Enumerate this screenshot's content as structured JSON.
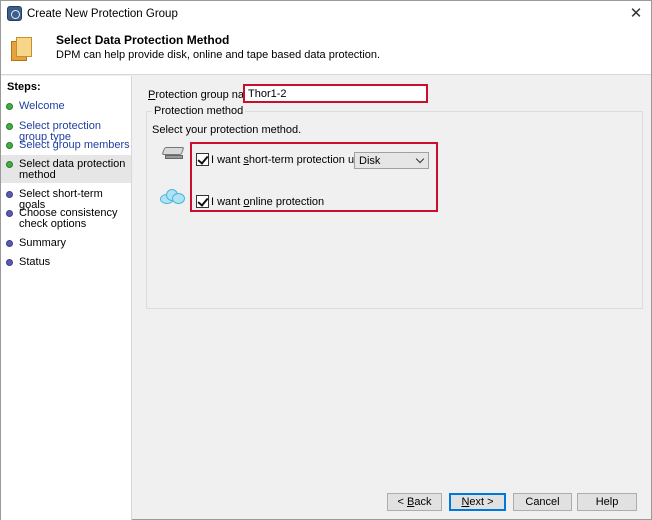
{
  "window": {
    "title": "Create New Protection Group",
    "close_glyph": "✕"
  },
  "header": {
    "title": "Select Data Protection Method",
    "subtitle": "DPM can help provide disk, online and tape based data protection."
  },
  "sidebar": {
    "steps_label": "Steps:",
    "items": [
      {
        "label": "Welcome",
        "state": "done"
      },
      {
        "label": "Select protection group type",
        "state": "done"
      },
      {
        "label": "Select group members",
        "state": "done"
      },
      {
        "label": "Select data protection method",
        "state": "current"
      },
      {
        "label": "Select short-term goals",
        "state": "todo"
      },
      {
        "label": "Choose consistency check options",
        "state": "todo"
      },
      {
        "label": "Summary",
        "state": "todo"
      },
      {
        "label": "Status",
        "state": "todo"
      }
    ]
  },
  "main": {
    "pg_name_label_prefix": "P",
    "pg_name_label_rest": "rotection group name:",
    "pg_name_value": "Thor1-2",
    "method_group_title": "Protection method",
    "method_desc": "Select your protection method.",
    "short_term": {
      "label_pre": "I want ",
      "label_u": "s",
      "label_post": "hort-term protection using:",
      "checked": true,
      "selected_option": "Disk"
    },
    "online": {
      "label_pre": "I want ",
      "label_u": "o",
      "label_post": "nline protection",
      "checked": true
    }
  },
  "buttons": {
    "back_prefix": "< ",
    "back_u": "B",
    "back_rest": "ack",
    "next_u": "N",
    "next_rest": "ext >",
    "cancel": "Cancel",
    "help": "Help"
  },
  "colors": {
    "highlight": "#c8102e",
    "step_link": "#1f3f9f",
    "step_done": "#3fae3f",
    "step_todo": "#5b5ab0"
  },
  "icons": {
    "app": "dpm-app-icon",
    "header": "protection-group-icon",
    "disk": "disk-icon",
    "cloud": "cloud-icon"
  }
}
